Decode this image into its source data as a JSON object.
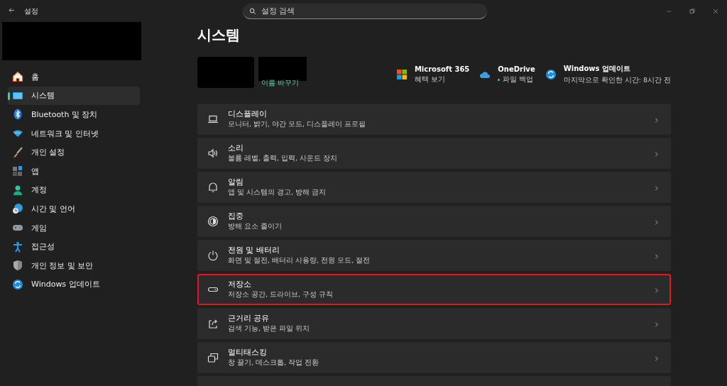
{
  "window": {
    "title": "설정"
  },
  "search": {
    "placeholder": "설정 검색"
  },
  "sidebar": {
    "items": [
      {
        "label": "홈",
        "kind": "home",
        "selected": false
      },
      {
        "label": "시스템",
        "kind": "system",
        "selected": true
      },
      {
        "label": "Bluetooth 및 장치",
        "kind": "bluetooth",
        "selected": false
      },
      {
        "label": "네트워크 및 인터넷",
        "kind": "network",
        "selected": false
      },
      {
        "label": "개인 설정",
        "kind": "brush",
        "selected": false
      },
      {
        "label": "앱",
        "kind": "apps",
        "selected": false
      },
      {
        "label": "계정",
        "kind": "account",
        "selected": false
      },
      {
        "label": "시간 및 언어",
        "kind": "time",
        "selected": false
      },
      {
        "label": "게임",
        "kind": "game",
        "selected": false
      },
      {
        "label": "접근성",
        "kind": "access",
        "selected": false
      },
      {
        "label": "개인 정보 및 보안",
        "kind": "shield",
        "selected": false
      },
      {
        "label": "Windows 업데이트",
        "kind": "update",
        "selected": false
      }
    ]
  },
  "page": {
    "title": "시스템",
    "rename_link": "이름 바꾸기"
  },
  "services": [
    {
      "kind": "m365",
      "title": "Microsoft 365",
      "subtitle": "혜택 보기",
      "dot": false
    },
    {
      "kind": "onedrive",
      "title": "OneDrive",
      "subtitle": "파일 백업",
      "dot": true
    },
    {
      "kind": "update",
      "title": "Windows 업데이트",
      "subtitle": "마지막으로 확인한 시간: 8시간 전",
      "dot": false
    }
  ],
  "settings": [
    {
      "kind": "display",
      "title": "디스플레이",
      "subtitle": "모니터, 밝기, 야간 모드, 디스플레이 프로필",
      "highlighted": false
    },
    {
      "kind": "sound",
      "title": "소리",
      "subtitle": "볼륨 레벨, 출력, 입력, 사운드 장치",
      "highlighted": false
    },
    {
      "kind": "bell",
      "title": "알림",
      "subtitle": "앱 및 시스템의 경고, 방해 금지",
      "highlighted": false
    },
    {
      "kind": "focus",
      "title": "집중",
      "subtitle": "방해 요소 줄이기",
      "highlighted": false
    },
    {
      "kind": "power",
      "title": "전원 및 배터리",
      "subtitle": "화면 및 절전, 배터리 사용량, 전원 모드, 절전",
      "highlighted": false
    },
    {
      "kind": "storage",
      "title": "저장소",
      "subtitle": "저장소 공간, 드라이브, 구성 규칙",
      "highlighted": true
    },
    {
      "kind": "share",
      "title": "근거리 공유",
      "subtitle": "검색 기능, 받은 파일 위치",
      "highlighted": false
    },
    {
      "kind": "multitask",
      "title": "멀티태스킹",
      "subtitle": "창 끌기, 데스크톱, 작업 전환",
      "highlighted": false
    }
  ]
}
